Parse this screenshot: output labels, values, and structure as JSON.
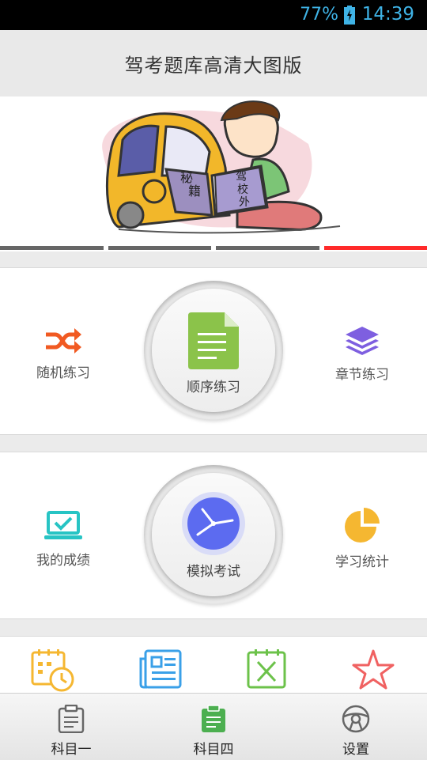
{
  "status": {
    "battery": "77%",
    "time": "14:39"
  },
  "header": {
    "title": "驾考题库高清大图版"
  },
  "banner": {
    "book_left_text": [
      "秘",
      "籍"
    ],
    "book_right_text": [
      "驾",
      "校",
      "外"
    ],
    "indicator_count": 4,
    "active_index": 3,
    "indicator_color": "#666666",
    "active_color": "#ff2a2a"
  },
  "practice": {
    "random_label": "随机练习",
    "sequential_label": "顺序练习",
    "chapter_label": "章节练习"
  },
  "exam": {
    "scores_label": "我的成绩",
    "mock_label": "模拟考试",
    "stats_label": "学习统计"
  },
  "tools": {
    "items": [
      "calendar-clock-icon",
      "news-icon",
      "wrong-answers-icon",
      "favorites-star-icon"
    ]
  },
  "bottom_nav": {
    "items": [
      {
        "label": "科目一",
        "icon": "clipboard-icon",
        "active": false
      },
      {
        "label": "科目四",
        "icon": "clipboard-icon",
        "active": true
      },
      {
        "label": "设置",
        "icon": "steering-wheel-icon",
        "active": false
      }
    ]
  },
  "colors": {
    "random": "#f15a22",
    "sequential": "#8bc34a",
    "chapter": "#7e5fe0",
    "scores": "#27c4c4",
    "mock": "#5c6bf0",
    "stats": "#f5b731",
    "active_nav": "#4caf50"
  }
}
